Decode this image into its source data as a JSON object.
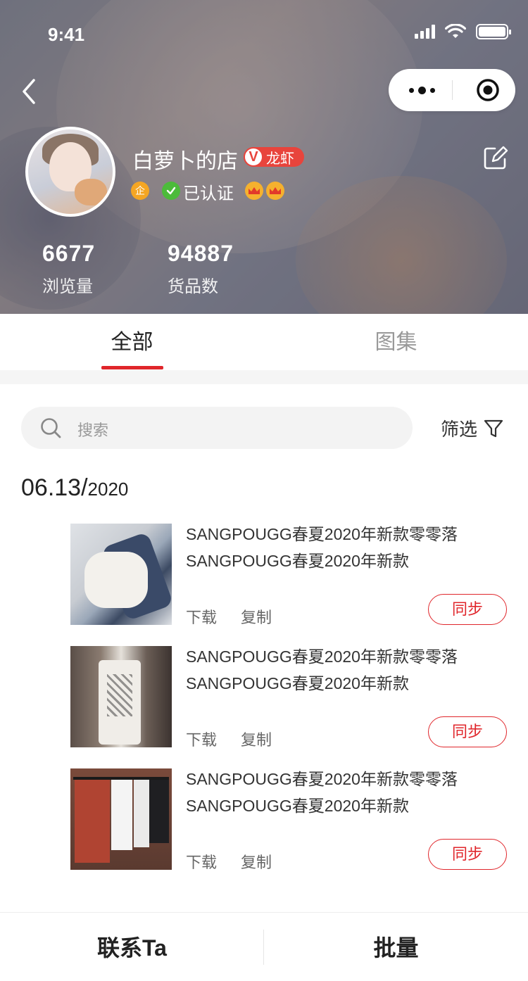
{
  "status_bar": {
    "time": "9:41"
  },
  "shop": {
    "name": "白萝卜的店",
    "vip_badge_mark": "V",
    "vip_badge_label": "龙虾",
    "enterprise_mark": "企",
    "verified_label": "已认证",
    "crown_count": 2
  },
  "stats": {
    "views_value": "6677",
    "views_label": "浏览量",
    "goods_value": "94887",
    "goods_label": "货品数"
  },
  "tabs": [
    {
      "label": "全部",
      "active": true
    },
    {
      "label": "图集",
      "active": false
    }
  ],
  "search": {
    "placeholder": "搜索"
  },
  "filter": {
    "label": "筛选"
  },
  "date_group": {
    "date": "06.13/",
    "year": "2020"
  },
  "items": [
    {
      "title": "SANGPOUGG春夏2020年新款零零落SANGPOUGG春夏2020年新款",
      "download_label": "下载",
      "copy_label": "复制",
      "sync_label": "同步"
    },
    {
      "title": "SANGPOUGG春夏2020年新款零零落SANGPOUGG春夏2020年新款",
      "download_label": "下载",
      "copy_label": "复制",
      "sync_label": "同步"
    },
    {
      "title": "SANGPOUGG春夏2020年新款零零落SANGPOUGG春夏2020年新款",
      "download_label": "下载",
      "copy_label": "复制",
      "sync_label": "同步"
    }
  ],
  "bottom_bar": {
    "contact_label": "联系Ta",
    "batch_label": "批量"
  },
  "colors": {
    "accent": "#e0262b",
    "verified": "#4cbb3a",
    "enterprise": "#f5a623"
  }
}
